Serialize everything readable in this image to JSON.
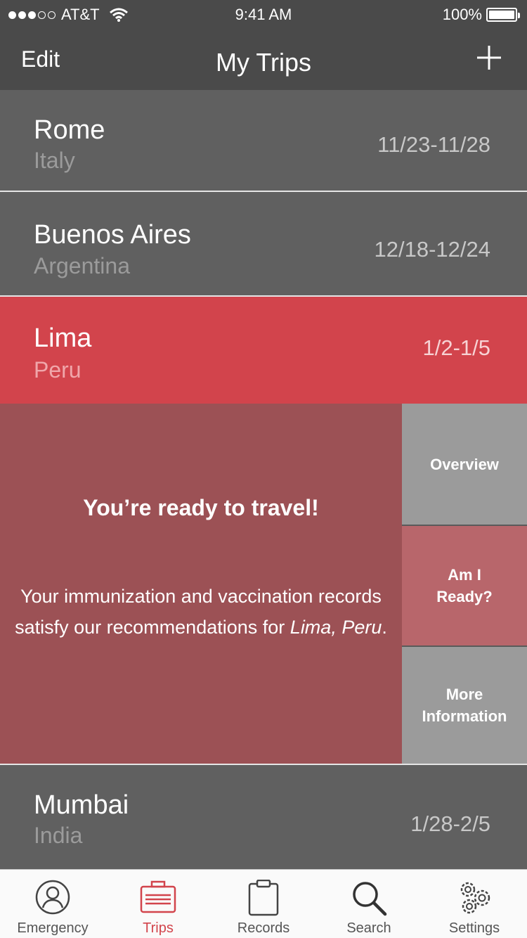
{
  "status": {
    "carrier": "AT&T",
    "time": "9:41 AM",
    "battery": "100%",
    "signal_bars_filled": 3,
    "signal_bars_total": 5
  },
  "nav": {
    "edit_label": "Edit",
    "title": "My Trips",
    "add_icon": "plus-icon"
  },
  "trips": [
    {
      "city": "Rome",
      "country": "Italy",
      "dates": "11/23-11/28"
    },
    {
      "city": "Buenos Aires",
      "country": "Argentina",
      "dates": "12/18-12/24"
    },
    {
      "city": "Lima",
      "country": "Peru",
      "dates": "1/2-1/5"
    },
    {
      "city": "Mumbai",
      "country": "India",
      "dates": "1/28-2/5"
    }
  ],
  "detail": {
    "title": "You’re ready to travel!",
    "body": "Your immunization and vaccination records satisfy our recommendations for",
    "place": "Lima, Peru",
    "period": "."
  },
  "side_tabs": [
    {
      "label": "Overview"
    },
    {
      "label": "Am I\nReady?"
    },
    {
      "label": "More\nInformation"
    }
  ],
  "tab_bar": [
    {
      "label": "Emergency",
      "icon": "person-icon"
    },
    {
      "label": "Trips",
      "icon": "suitcase-icon"
    },
    {
      "label": "Records",
      "icon": "clipboard-icon"
    },
    {
      "label": "Search",
      "icon": "search-icon"
    },
    {
      "label": "Settings",
      "icon": "gears-icon"
    }
  ],
  "colors": {
    "accent": "#d2444c",
    "detail_bg": "#9c5155",
    "row_bg": "#606060",
    "header_bg": "#4a4a4a"
  }
}
